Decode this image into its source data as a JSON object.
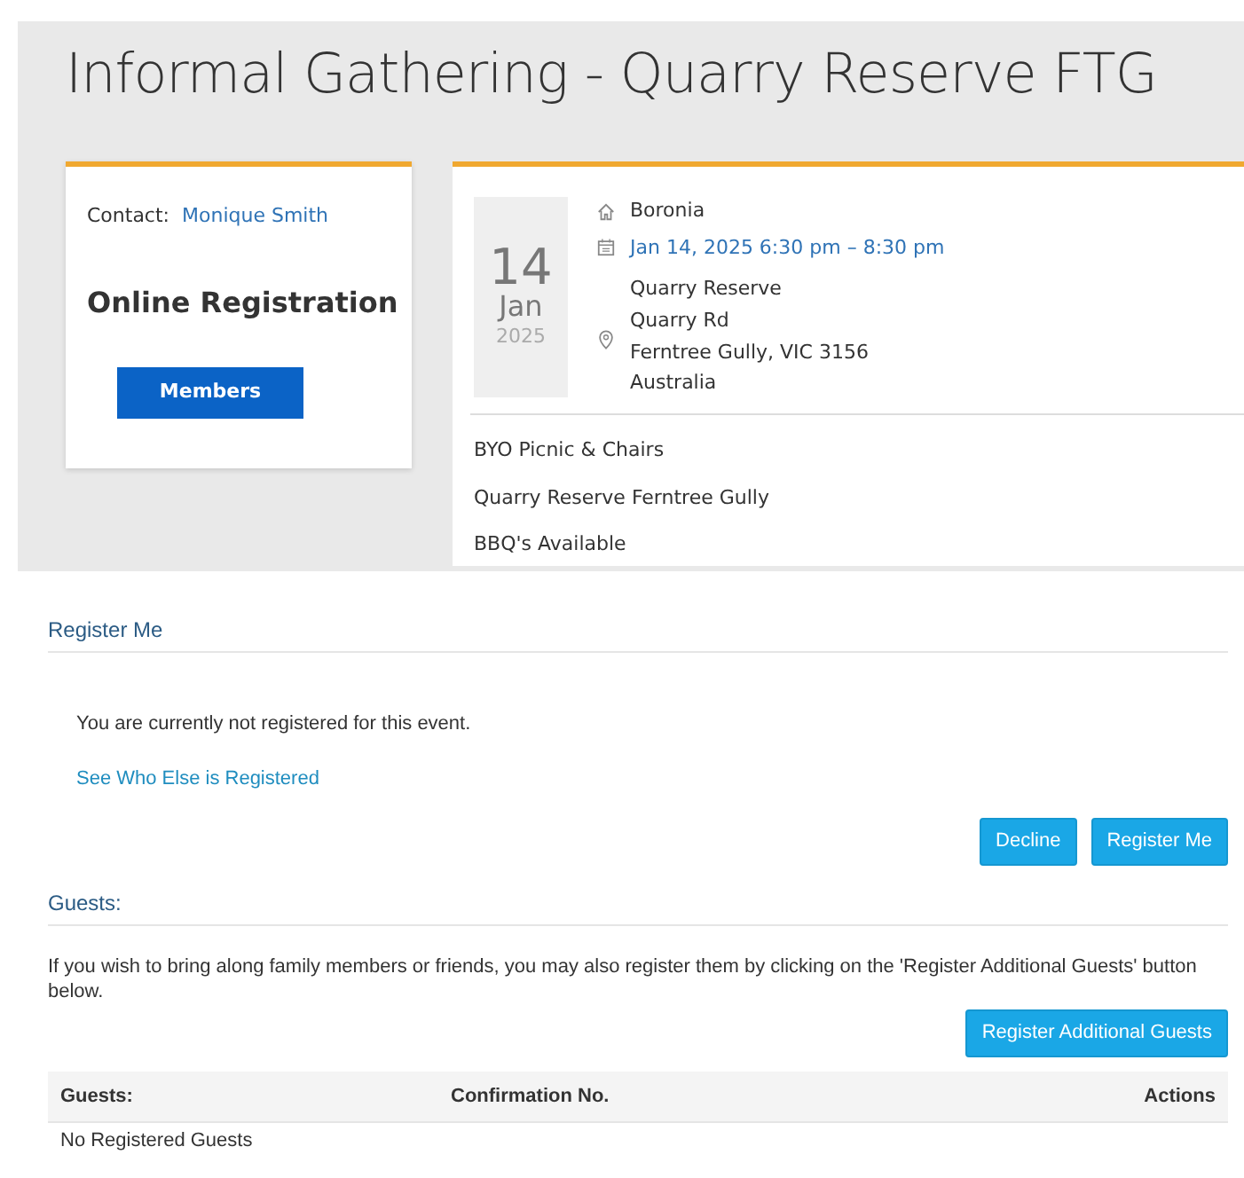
{
  "event": {
    "title": "Informal Gathering - Quarry Reserve FTG"
  },
  "contact_card": {
    "contact_label": "Contact:",
    "contact_name": "Monique Smith",
    "heading": "Online Registration",
    "button": "Members"
  },
  "details": {
    "day": "14",
    "month": "Jan",
    "year": "2025",
    "area": "Boronia",
    "datetime": "Jan 14, 2025 6:30 pm – 8:30 pm",
    "address": [
      "Quarry Reserve",
      "Quarry Rd",
      "Ferntree Gully, VIC 3156",
      "Australia"
    ],
    "notes": [
      "BYO Picnic & Chairs",
      "Quarry Reserve Ferntree Gully",
      "BBQ's Available"
    ]
  },
  "register": {
    "heading": "Register Me",
    "status": "You are currently not registered for this event.",
    "link": "See Who Else is Registered",
    "buttons": [
      "Decline",
      "Register Me"
    ]
  },
  "guests": {
    "heading": "Guests:",
    "info": "If you wish to bring along family members or friends, you may also register them by clicking on the 'Register Additional Guests' button below.",
    "button": "Register Additional Guests",
    "table": {
      "columns": [
        "Guests:",
        "Confirmation No.",
        "Actions"
      ],
      "empty": "No Registered Guests"
    }
  }
}
